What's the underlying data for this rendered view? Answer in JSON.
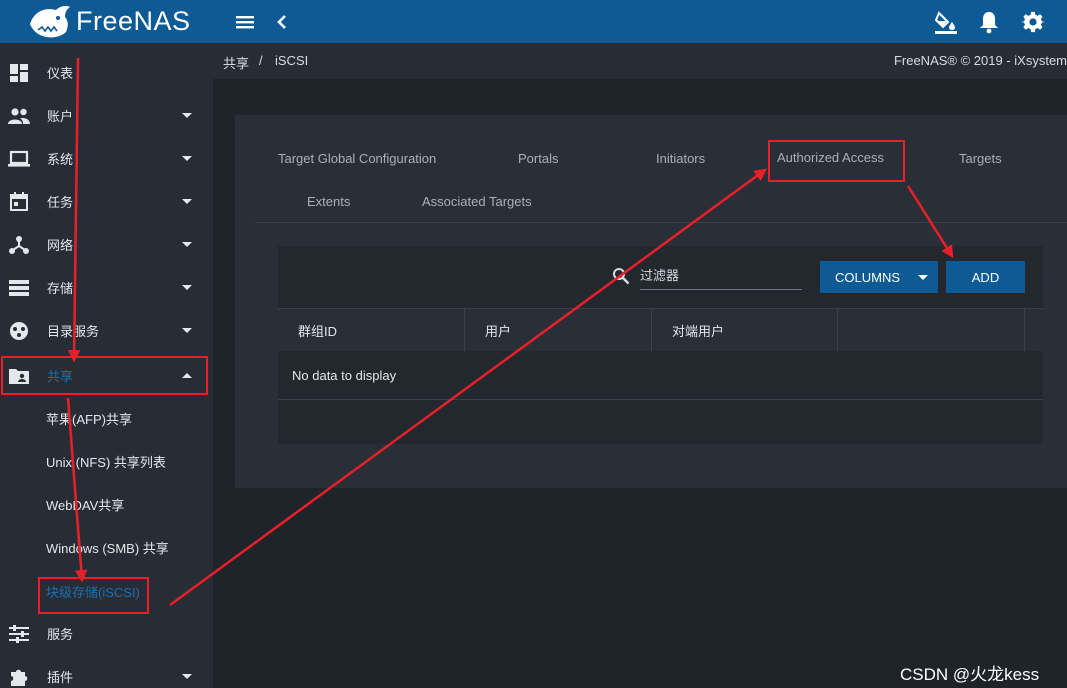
{
  "app": {
    "name": "FreeNAS"
  },
  "topbar": {
    "menu_icon": "hamburger-menu-icon",
    "back_icon": "chevron-left-icon",
    "theme_icon": "paint-bucket-icon",
    "notifications_icon": "bell-icon",
    "settings_icon": "gear-icon"
  },
  "sidebar": {
    "items": [
      {
        "label": "仪表",
        "icon": "dashboard-icon"
      },
      {
        "label": "账户",
        "icon": "people-icon"
      },
      {
        "label": "系统",
        "icon": "laptop-icon"
      },
      {
        "label": "任务",
        "icon": "calendar-icon"
      },
      {
        "label": "网络",
        "icon": "network-icon"
      },
      {
        "label": "存储",
        "icon": "storage-icon"
      },
      {
        "label": "目录服务",
        "icon": "directory-icon"
      },
      {
        "label": "共享",
        "icon": "folder-shared-icon"
      }
    ],
    "sub_items": [
      {
        "label": "苹果(AFP)共享"
      },
      {
        "label": "Unix (NFS) 共享列表"
      },
      {
        "label": "WebDAV共享"
      },
      {
        "label": "Windows (SMB) 共享"
      },
      {
        "label": "块级存储(iSCSI)"
      }
    ],
    "bottom_items": [
      {
        "label": "服务",
        "icon": "sliders-icon"
      },
      {
        "label": "插件",
        "icon": "puzzle-icon"
      }
    ]
  },
  "breadcrumb": {
    "parent": "共享",
    "separator": "/",
    "current": "iSCSI"
  },
  "copyright": "FreeNAS® © 2019 - iXsystem",
  "tabs": [
    {
      "label": "Target Global Configuration"
    },
    {
      "label": "Portals"
    },
    {
      "label": "Initiators"
    },
    {
      "label": "Authorized Access"
    },
    {
      "label": "Targets"
    },
    {
      "label": "Extents"
    },
    {
      "label": "Associated Targets"
    }
  ],
  "toolbar": {
    "filter_placeholder": "过滤器",
    "columns_label": "COLUMNS",
    "add_label": "ADD"
  },
  "table": {
    "columns": [
      "群组ID",
      "用户",
      "对端用户",
      ""
    ],
    "empty_message": "No data to display"
  },
  "colors": {
    "topbar": "#0e5a94",
    "sidebar": "#282d35",
    "panel": "#2a2f37",
    "accent": "#1b6fb3",
    "annotation": "#e8202a"
  },
  "watermark": "CSDN @火龙kess"
}
